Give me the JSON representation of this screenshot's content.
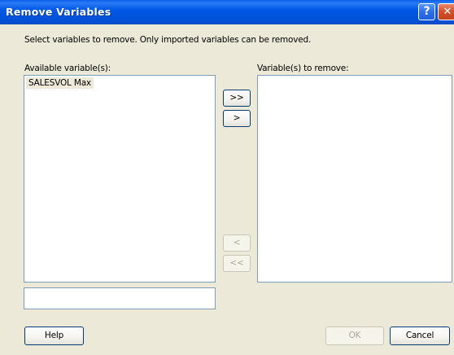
{
  "window": {
    "title": "Remove Variables",
    "help_glyph": "?",
    "close_glyph": "✕"
  },
  "instruction": "Select variables to remove. Only imported variables can be removed.",
  "available": {
    "label": "Available variable(s):",
    "items": [
      "SALESVOL Max"
    ]
  },
  "to_remove": {
    "label": "Variable(s) to remove:",
    "items": []
  },
  "filter_value": "",
  "move_buttons": {
    "add_all": ">>",
    "add": ">",
    "remove": "<",
    "remove_all": "<<"
  },
  "buttons": {
    "help": "Help",
    "ok": "OK",
    "cancel": "Cancel"
  },
  "colors": {
    "titlebar": "#0054e3",
    "dialog_bg": "#ece9d8",
    "list_border": "#7f9db9",
    "selected_item_bg": "#ece9d8"
  }
}
